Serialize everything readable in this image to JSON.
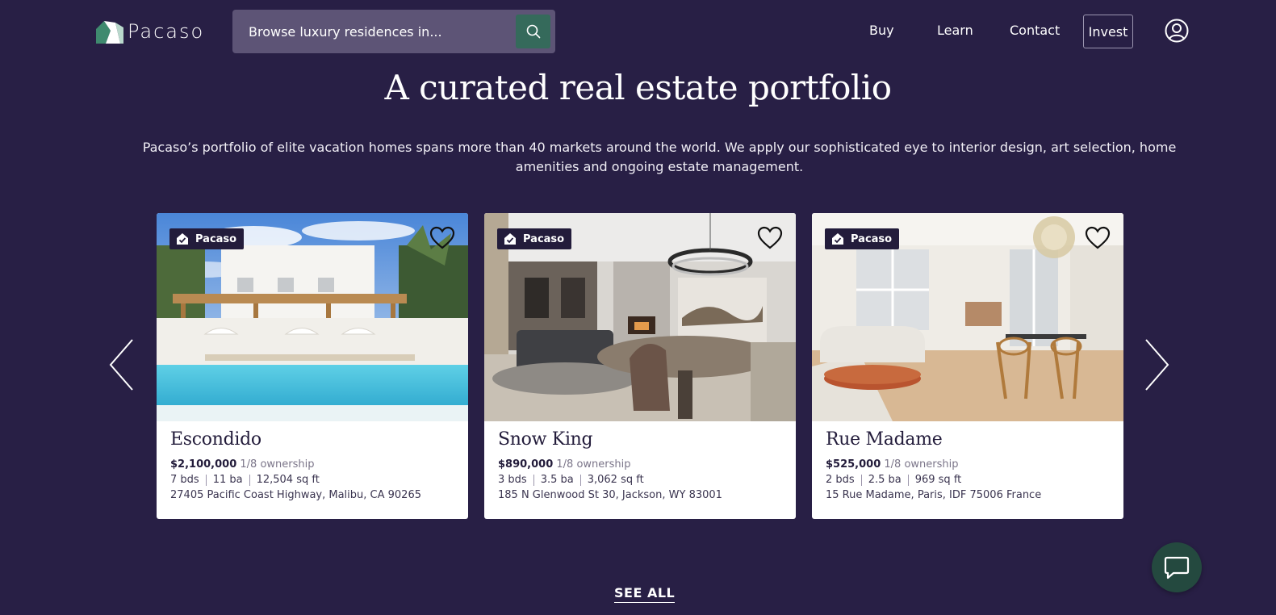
{
  "header": {
    "brand": "Pacaso",
    "search": {
      "placeholder": "Browse luxury residences in..."
    },
    "nav": [
      {
        "label": "Buy"
      },
      {
        "label": "Learn"
      },
      {
        "label": "Contact"
      }
    ],
    "invest_label": "Invest"
  },
  "hero": {
    "title": "A curated real estate portfolio",
    "description": "Pacaso’s portfolio of elite vacation homes spans more than 40 markets around the world. We apply our sophisticated eye to interior design, art selection, home amenities and ongoing estate management."
  },
  "listings": [
    {
      "badge": "Pacaso",
      "name": "Escondido",
      "price": "$2,100,000",
      "ownership": "1/8 ownership",
      "beds": "7 bds",
      "baths": "11 ba",
      "sqft": "12,504 sq ft",
      "address": "27405 Pacific Coast Highway, Malibu, CA 90265"
    },
    {
      "badge": "Pacaso",
      "name": "Snow King",
      "price": "$890,000",
      "ownership": "1/8 ownership",
      "beds": "3 bds",
      "baths": "3.5 ba",
      "sqft": "3,062 sq ft",
      "address": "185 N Glenwood St 30, Jackson, WY 83001"
    },
    {
      "badge": "Pacaso",
      "name": "Rue Madame",
      "price": "$525,000",
      "ownership": "1/8 ownership",
      "beds": "2 bds",
      "baths": "2.5 ba",
      "sqft": "969 sq ft",
      "address": "15 Rue Madame, Paris, IDF 75006 France"
    }
  ],
  "see_all_label": "SEE ALL",
  "icons": {
    "search": "search-icon",
    "user": "user-circle-icon",
    "heart": "heart-icon",
    "chat": "chat-bubble-icon",
    "prev": "chevron-left-icon",
    "next": "chevron-right-icon"
  },
  "colors": {
    "background": "#281f45",
    "search_bg": "#5d5476",
    "accent_green": "#356a5b",
    "chat_bg": "#24493f",
    "badge_bg": "#231c3b"
  }
}
